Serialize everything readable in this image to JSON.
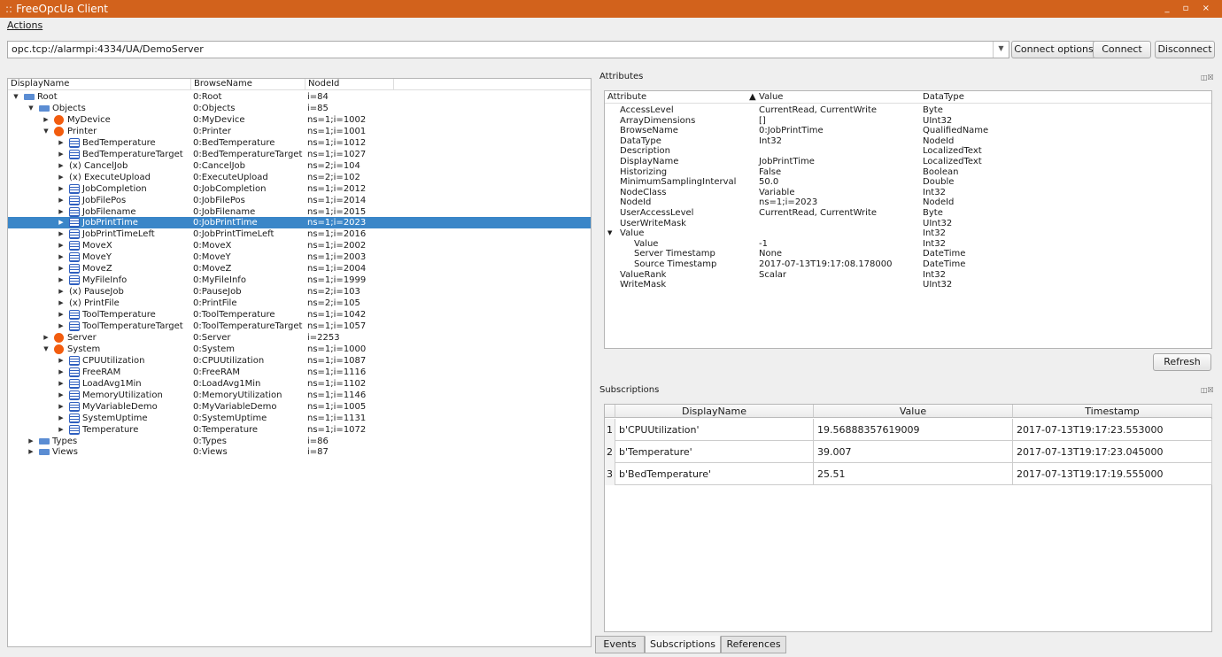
{
  "window": {
    "title": "FreeOpcUa Client",
    "controls": "_ ▫ ×"
  },
  "menu": {
    "actions": "Actions"
  },
  "connection": {
    "url": "opc.tcp://alarmpi:4334/UA/DemoServer",
    "connect_options": "Connect options",
    "connect": "Connect",
    "disconnect": "Disconnect"
  },
  "tree": {
    "headers": [
      "DisplayName",
      "BrowseName",
      "NodeId"
    ],
    "rows": [
      {
        "name": "Root",
        "browse": "0:Root",
        "id": "i=84",
        "lvl": 0,
        "icon": "folder",
        "exp": "open"
      },
      {
        "name": "Objects",
        "browse": "0:Objects",
        "id": "i=85",
        "lvl": 1,
        "icon": "folder",
        "exp": "open"
      },
      {
        "name": "MyDevice",
        "browse": "0:MyDevice",
        "id": "ns=1;i=1002",
        "lvl": 2,
        "icon": "object",
        "exp": "closed"
      },
      {
        "name": "Printer",
        "browse": "0:Printer",
        "id": "ns=1;i=1001",
        "lvl": 2,
        "icon": "object",
        "exp": "open"
      },
      {
        "name": "BedTemperature",
        "browse": "0:BedTemperature",
        "id": "ns=1;i=1012",
        "lvl": 3,
        "icon": "variable",
        "exp": "closed"
      },
      {
        "name": "BedTemperatureTarget",
        "browse": "0:BedTemperatureTarget",
        "id": "ns=1;i=1027",
        "lvl": 3,
        "icon": "variable",
        "exp": "closed"
      },
      {
        "name": "CancelJob",
        "browse": "0:CancelJob",
        "id": "ns=2;i=104",
        "lvl": 3,
        "icon": "method",
        "exp": "closed"
      },
      {
        "name": "ExecuteUpload",
        "browse": "0:ExecuteUpload",
        "id": "ns=2;i=102",
        "lvl": 3,
        "icon": "method",
        "exp": "closed"
      },
      {
        "name": "JobCompletion",
        "browse": "0:JobCompletion",
        "id": "ns=1;i=2012",
        "lvl": 3,
        "icon": "variable",
        "exp": "closed"
      },
      {
        "name": "JobFilePos",
        "browse": "0:JobFilePos",
        "id": "ns=1;i=2014",
        "lvl": 3,
        "icon": "variable",
        "exp": "closed"
      },
      {
        "name": "JobFilename",
        "browse": "0:JobFilename",
        "id": "ns=1;i=2015",
        "lvl": 3,
        "icon": "variable",
        "exp": "closed"
      },
      {
        "name": "JobPrintTime",
        "browse": "0:JobPrintTime",
        "id": "ns=1;i=2023",
        "lvl": 3,
        "icon": "variable",
        "exp": "closed",
        "selected": true
      },
      {
        "name": "JobPrintTimeLeft",
        "browse": "0:JobPrintTimeLeft",
        "id": "ns=1;i=2016",
        "lvl": 3,
        "icon": "variable",
        "exp": "closed"
      },
      {
        "name": "MoveX",
        "browse": "0:MoveX",
        "id": "ns=1;i=2002",
        "lvl": 3,
        "icon": "variable",
        "exp": "closed"
      },
      {
        "name": "MoveY",
        "browse": "0:MoveY",
        "id": "ns=1;i=2003",
        "lvl": 3,
        "icon": "variable",
        "exp": "closed"
      },
      {
        "name": "MoveZ",
        "browse": "0:MoveZ",
        "id": "ns=1;i=2004",
        "lvl": 3,
        "icon": "variable",
        "exp": "closed"
      },
      {
        "name": "MyFileInfo",
        "browse": "0:MyFileInfo",
        "id": "ns=1;i=1999",
        "lvl": 3,
        "icon": "variable",
        "exp": "closed"
      },
      {
        "name": "PauseJob",
        "browse": "0:PauseJob",
        "id": "ns=2;i=103",
        "lvl": 3,
        "icon": "method",
        "exp": "closed"
      },
      {
        "name": "PrintFile",
        "browse": "0:PrintFile",
        "id": "ns=2;i=105",
        "lvl": 3,
        "icon": "method",
        "exp": "closed"
      },
      {
        "name": "ToolTemperature",
        "browse": "0:ToolTemperature",
        "id": "ns=1;i=1042",
        "lvl": 3,
        "icon": "variable",
        "exp": "closed"
      },
      {
        "name": "ToolTemperatureTarget",
        "browse": "0:ToolTemperatureTarget",
        "id": "ns=1;i=1057",
        "lvl": 3,
        "icon": "variable",
        "exp": "closed"
      },
      {
        "name": "Server",
        "browse": "0:Server",
        "id": "i=2253",
        "lvl": 2,
        "icon": "object",
        "exp": "closed"
      },
      {
        "name": "System",
        "browse": "0:System",
        "id": "ns=1;i=1000",
        "lvl": 2,
        "icon": "object",
        "exp": "open"
      },
      {
        "name": "CPUUtilization",
        "browse": "0:CPUUtilization",
        "id": "ns=1;i=1087",
        "lvl": 3,
        "icon": "variable",
        "exp": "closed"
      },
      {
        "name": "FreeRAM",
        "browse": "0:FreeRAM",
        "id": "ns=1;i=1116",
        "lvl": 3,
        "icon": "variable",
        "exp": "closed"
      },
      {
        "name": "LoadAvg1Min",
        "browse": "0:LoadAvg1Min",
        "id": "ns=1;i=1102",
        "lvl": 3,
        "icon": "variable",
        "exp": "closed"
      },
      {
        "name": "MemoryUtilization",
        "browse": "0:MemoryUtilization",
        "id": "ns=1;i=1146",
        "lvl": 3,
        "icon": "variable",
        "exp": "closed"
      },
      {
        "name": "MyVariableDemo",
        "browse": "0:MyVariableDemo",
        "id": "ns=1;i=1005",
        "lvl": 3,
        "icon": "variable",
        "exp": "closed"
      },
      {
        "name": "SystemUptime",
        "browse": "0:SystemUptime",
        "id": "ns=1;i=1131",
        "lvl": 3,
        "icon": "variable",
        "exp": "closed"
      },
      {
        "name": "Temperature",
        "browse": "0:Temperature",
        "id": "ns=1;i=1072",
        "lvl": 3,
        "icon": "variable",
        "exp": "closed"
      },
      {
        "name": "Types",
        "browse": "0:Types",
        "id": "i=86",
        "lvl": 1,
        "icon": "folder",
        "exp": "closed"
      },
      {
        "name": "Views",
        "browse": "0:Views",
        "id": "i=87",
        "lvl": 1,
        "icon": "folder",
        "exp": "closed"
      }
    ]
  },
  "attributes": {
    "title": "Attributes",
    "headers": [
      "Attribute",
      "Value",
      "DataType"
    ],
    "rows": [
      {
        "attr": "AccessLevel",
        "value": "CurrentRead, CurrentWrite",
        "type": "Byte",
        "lvl": 0
      },
      {
        "attr": "ArrayDimensions",
        "value": "[]",
        "type": "UInt32",
        "lvl": 0
      },
      {
        "attr": "BrowseName",
        "value": "0:JobPrintTime",
        "type": "QualifiedName",
        "lvl": 0
      },
      {
        "attr": "DataType",
        "value": "Int32",
        "type": "NodeId",
        "lvl": 0
      },
      {
        "attr": "Description",
        "value": "",
        "type": "LocalizedText",
        "lvl": 0
      },
      {
        "attr": "DisplayName",
        "value": "JobPrintTime",
        "type": "LocalizedText",
        "lvl": 0
      },
      {
        "attr": "Historizing",
        "value": "False",
        "type": "Boolean",
        "lvl": 0
      },
      {
        "attr": "MinimumSamplingInterval",
        "value": "50.0",
        "type": "Double",
        "lvl": 0
      },
      {
        "attr": "NodeClass",
        "value": "Variable",
        "type": "Int32",
        "lvl": 0
      },
      {
        "attr": "NodeId",
        "value": "ns=1;i=2023",
        "type": "NodeId",
        "lvl": 0
      },
      {
        "attr": "UserAccessLevel",
        "value": "CurrentRead, CurrentWrite",
        "type": "Byte",
        "lvl": 0
      },
      {
        "attr": "UserWriteMask",
        "value": "",
        "type": "UInt32",
        "lvl": 0
      },
      {
        "attr": "Value",
        "value": "",
        "type": "Int32",
        "lvl": 0,
        "expandable": true
      },
      {
        "attr": "Value",
        "value": "-1",
        "type": "Int32",
        "lvl": 1
      },
      {
        "attr": "Server Timestamp",
        "value": "None",
        "type": "DateTime",
        "lvl": 1
      },
      {
        "attr": "Source Timestamp",
        "value": "2017-07-13T19:17:08.178000",
        "type": "DateTime",
        "lvl": 1
      },
      {
        "attr": "ValueRank",
        "value": "Scalar",
        "type": "Int32",
        "lvl": 0
      },
      {
        "attr": "WriteMask",
        "value": "",
        "type": "UInt32",
        "lvl": 0
      }
    ],
    "refresh": "Refresh"
  },
  "subscriptions": {
    "title": "Subscriptions",
    "headers": [
      "DisplayName",
      "Value",
      "Timestamp"
    ],
    "rows": [
      {
        "n": "1",
        "name": "b'CPUUtilization'",
        "value": "19.56888357619009",
        "ts": "2017-07-13T19:17:23.553000"
      },
      {
        "n": "2",
        "name": "b'Temperature'",
        "value": "39.007",
        "ts": "2017-07-13T19:17:23.045000"
      },
      {
        "n": "3",
        "name": "b'BedTemperature'",
        "value": "25.51",
        "ts": "2017-07-13T19:17:19.555000"
      }
    ]
  },
  "tabs": [
    "Events",
    "Subscriptions",
    "References"
  ]
}
